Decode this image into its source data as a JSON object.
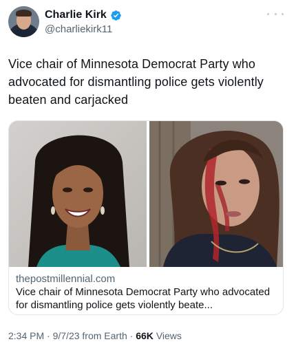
{
  "author": {
    "display_name": "Charlie Kirk",
    "handle": "@charliekirk11",
    "avatar_icon": "profile-photo",
    "verified_icon": "verified-badge-icon",
    "verified_color": "#1d9bf0"
  },
  "tweet": {
    "text": "Vice chair of Minnesota Democrat Party who advocated for dismantling police gets violently beaten and carjacked"
  },
  "card": {
    "domain": "thepostmillennial.com",
    "title": "Vice chair of Minnesota Democrat Party who advocated for dismantling police gets violently beate..."
  },
  "meta": {
    "time": "2:34 PM",
    "date": "9/7/23",
    "source": "from Earth",
    "separator": "·",
    "views_count": "66K",
    "views_label": "Views"
  },
  "colors": {
    "text_primary": "#0f1419",
    "text_secondary": "#536471",
    "border": "#dfe4e8"
  }
}
